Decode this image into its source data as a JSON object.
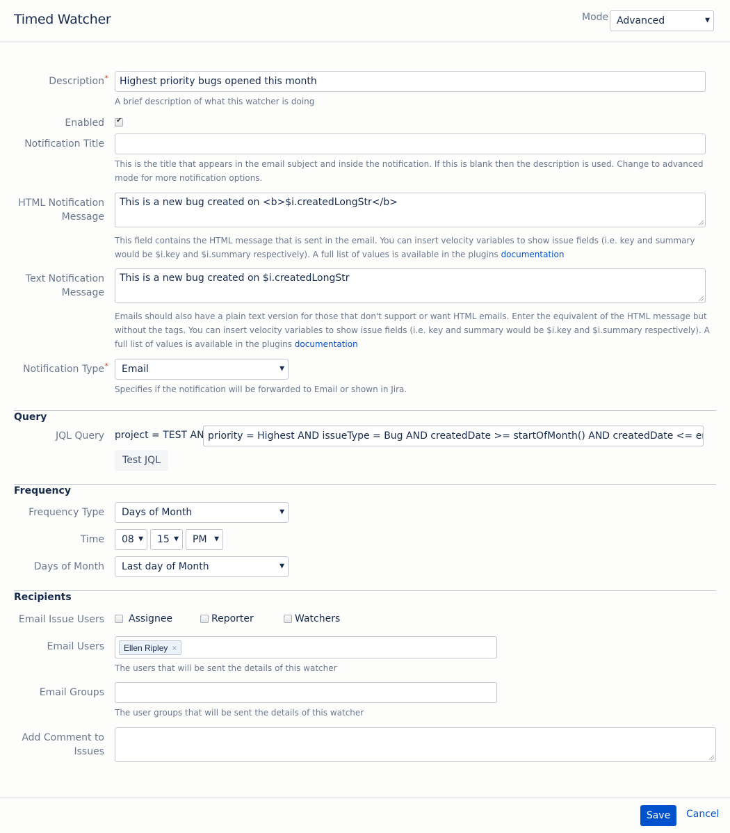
{
  "header": {
    "title": "Timed Watcher",
    "mode_label": "Mode",
    "mode_value": "Advanced"
  },
  "form": {
    "description": {
      "label": "Description",
      "required_mark": "*",
      "value": "Highest priority bugs opened this month",
      "help": "A brief description of what this watcher is doing"
    },
    "enabled": {
      "label": "Enabled",
      "checked": true
    },
    "notification_title": {
      "label": "Notification Title",
      "value": "",
      "help": "This is the title that appears in the email subject and inside the notification. If this is blank then the description is used. Change to advanced mode for more notification options."
    },
    "html_message": {
      "label_line1": "HTML Notification",
      "label_line2": "Message",
      "value": "This is a new bug created on <b>$i.createdLongStr</b>",
      "help": "This field contains the HTML message that is sent in the email. You can insert velocity variables to show issue fields (i.e. key and summary would be $i.key and $i.summary respectively). A full list of values is available in the plugins ",
      "help_link": "documentation"
    },
    "text_message": {
      "label_line1": "Text Notification",
      "label_line2": "Message",
      "value": "This is a new bug created on $i.createdLongStr",
      "help": "Emails should also have a plain text version for those that don't support or want HTML emails. Enter the equivalent of the HTML message but without the tags. You can insert velocity variables to show issue fields (i.e. key and summary would be $i.key and $i.summary respectively). A full list of values is available in the plugins ",
      "help_link": "documentation"
    },
    "notification_type": {
      "label": "Notification Type",
      "required_mark": "*",
      "value": "Email",
      "help": "Specifies if the notification will be forwarded to Email or shown in Jira."
    }
  },
  "query": {
    "section_title": "Query",
    "jql_label": "JQL Query",
    "jql_prefix": "project = TEST AND",
    "jql_value": "priority = Highest AND issueType = Bug AND createdDate >= startOfMonth() AND createdDate <= endOfMonth(",
    "test_button": "Test JQL"
  },
  "frequency": {
    "section_title": "Frequency",
    "type_label": "Frequency Type",
    "type_value": "Days of Month",
    "time_label": "Time",
    "hour": "08",
    "minute": "15",
    "ampm": "PM",
    "days_label": "Days of Month",
    "days_value": "Last day of Month"
  },
  "recipients": {
    "section_title": "Recipients",
    "issue_users_label": "Email Issue Users",
    "assignee": {
      "label": "Assignee",
      "checked": false
    },
    "reporter": {
      "label": "Reporter",
      "checked": false
    },
    "watchers": {
      "label": "Watchers",
      "checked": false
    },
    "users_label": "Email Users",
    "users": [
      {
        "name": "Ellen Ripley",
        "remove": "×"
      }
    ],
    "users_help": "The users that will be sent the details of this watcher",
    "groups_label": "Email Groups",
    "groups_value": "",
    "groups_help": "The user groups that will be sent the details of this watcher",
    "comment_label_line1": "Add Comment to",
    "comment_label_line2": "Issues",
    "comment_value": ""
  },
  "footer": {
    "save": "Save",
    "cancel": "Cancel"
  },
  "colors": {
    "accent": "#0052cc",
    "required": "#de350b"
  }
}
